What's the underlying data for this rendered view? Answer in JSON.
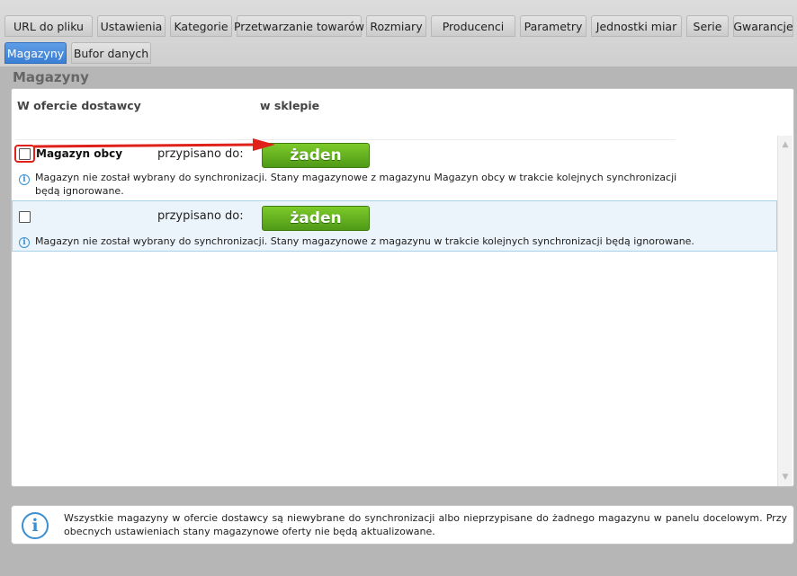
{
  "tabs_row1": [
    {
      "label": "URL do pliku"
    },
    {
      "label": "Ustawienia"
    },
    {
      "label": "Kategorie"
    },
    {
      "label": "Przetwarzanie towarów"
    },
    {
      "label": "Rozmiary"
    },
    {
      "label": "Producenci"
    },
    {
      "label": "Parametry"
    },
    {
      "label": "Jednostki miar"
    },
    {
      "label": "Serie"
    },
    {
      "label": "Gwarancje"
    }
  ],
  "tabs_row2": [
    {
      "label": "Magazyny",
      "active": true
    },
    {
      "label": "Bufor danych"
    }
  ],
  "section_title": "Magazyny",
  "headers": {
    "supplier": "W ofercie dostawcy",
    "shop": "w sklepie"
  },
  "rows": [
    {
      "store_name": "Magazyn obcy",
      "assigned_label": "przypisano do:",
      "button_label": "żaden",
      "message": "Magazyn nie został wybrany do synchronizacji. Stany magazynowe z magazynu Magazyn obcy w trakcie kolejnych synchronizacji będą ignorowane."
    },
    {
      "store_name": "",
      "assigned_label": "przypisano do:",
      "button_label": "żaden",
      "message": "Magazyn nie został wybrany do synchronizacji. Stany magazynowe z magazynu  w trakcie kolejnych synchronizacji będą ignorowane."
    }
  ],
  "footer_message": "Wszystkie magazyny w ofercie dostawcy są niewybrane do synchronizacji albo nieprzypisane do żadnego magazynu w panelu docelowym. Przy obecnych ustawieniach stany magazynowe oferty nie będą aktualizowane.",
  "colors": {
    "active_tab": "#3a7fd4",
    "button_green": "#5fae1f",
    "highlight_red": "#e0211a",
    "info_blue": "#3b8fd0"
  }
}
